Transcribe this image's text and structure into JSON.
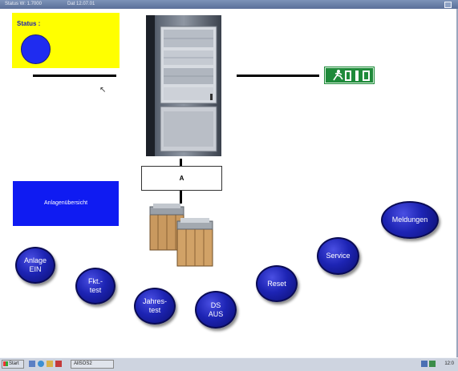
{
  "window": {
    "title": "Status  W: 1.7000",
    "datetime": "Dat 12.07.01"
  },
  "status": {
    "label": "Status :",
    "indicator_color": "#1f2cf0"
  },
  "device": {
    "box_label": "A"
  },
  "overview_button": {
    "label": "Anlagenübersicht"
  },
  "buttons": {
    "anlage_ein": "Anlage\nEIN",
    "fkt_test": "Fkt.-\ntest",
    "jahres_test": "Jahres-\ntest",
    "ds_aus": "DS\nAUS",
    "reset": "Reset",
    "service": "Service",
    "meldungen": "Meldungen"
  },
  "taskbar": {
    "start_label": "Start",
    "task_label": "AllSOS2",
    "clock": "12:0"
  },
  "colors": {
    "accent_yellow": "#ffff00",
    "panel_blue": "#0f1bf2",
    "button_blue": "#1d24b4",
    "exit_green": "#1f8a3a"
  }
}
